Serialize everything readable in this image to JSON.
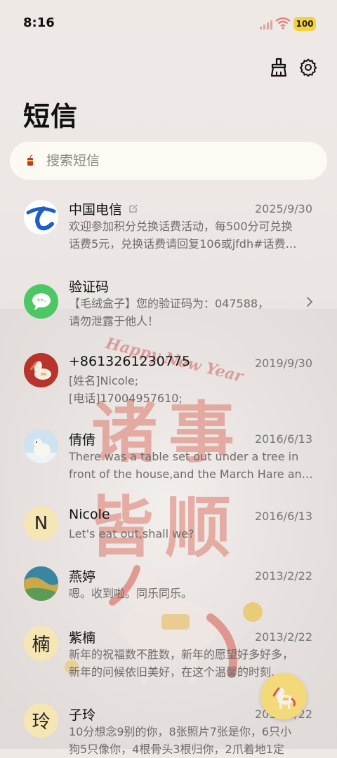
{
  "status_bar": {
    "time": "8:16",
    "battery": "100"
  },
  "header": {
    "title": "短信"
  },
  "search": {
    "placeholder": "搜索短信"
  },
  "background": {
    "line1": "诸事",
    "line2": "皆顺",
    "greeting": "Happy New Year"
  },
  "messages": [
    {
      "sender": "中国电信",
      "date": "2025/9/30",
      "preview": "欢迎参加积分兑换话费活动，每500分可兑换",
      "preview2": "话费5元，兑换话费请回复106或jfdh#话费…",
      "avatar": "china-telecom-logo"
    },
    {
      "sender": "验证码",
      "date": "",
      "preview": "【毛绒盒子】您的验证码为：047588，",
      "preview2": "请勿泄露于他人！",
      "avatar": "verification-message-icon"
    },
    {
      "sender": "+8613261230775",
      "date": "2019/9/30",
      "preview": "[姓名]Nicole;",
      "preview2": "[电话]17004957610;",
      "avatar": "horse-photo"
    },
    {
      "sender": "倩倩",
      "date": "2016/6/13",
      "preview": "There was a table set out under a tree in",
      "preview2": "front of the house,and the March Hare an…",
      "avatar": "polar-bear-photo"
    },
    {
      "sender": "Nicole",
      "date": "2016/6/13",
      "preview": "Let's eat out,shall we?",
      "preview2": "",
      "avatar_letter": "N"
    },
    {
      "sender": "燕婷",
      "date": "2013/2/22",
      "preview": "嗯。收到啦。同乐同乐。",
      "preview2": "",
      "avatar": "landscape-photo"
    },
    {
      "sender": "紫楠",
      "date": "2013/2/22",
      "preview": "新年的祝福数不胜数，新年的愿望好多好多，",
      "preview2": "新年的问候依旧美好，在这个温馨的时刻…",
      "avatar_letter": "楠"
    },
    {
      "sender": "子玲",
      "date": "2013/2/22",
      "preview": "10分想念9别的你，8张照片7张是你，6只小",
      "preview2": "狗5只像你，4根骨头3根归你，2爪着地1定",
      "avatar_letter": "玲"
    }
  ],
  "colors": {
    "accent": "#f3d97a",
    "telecom_blue": "#1f5ec8",
    "message_green": "#4cc764"
  }
}
